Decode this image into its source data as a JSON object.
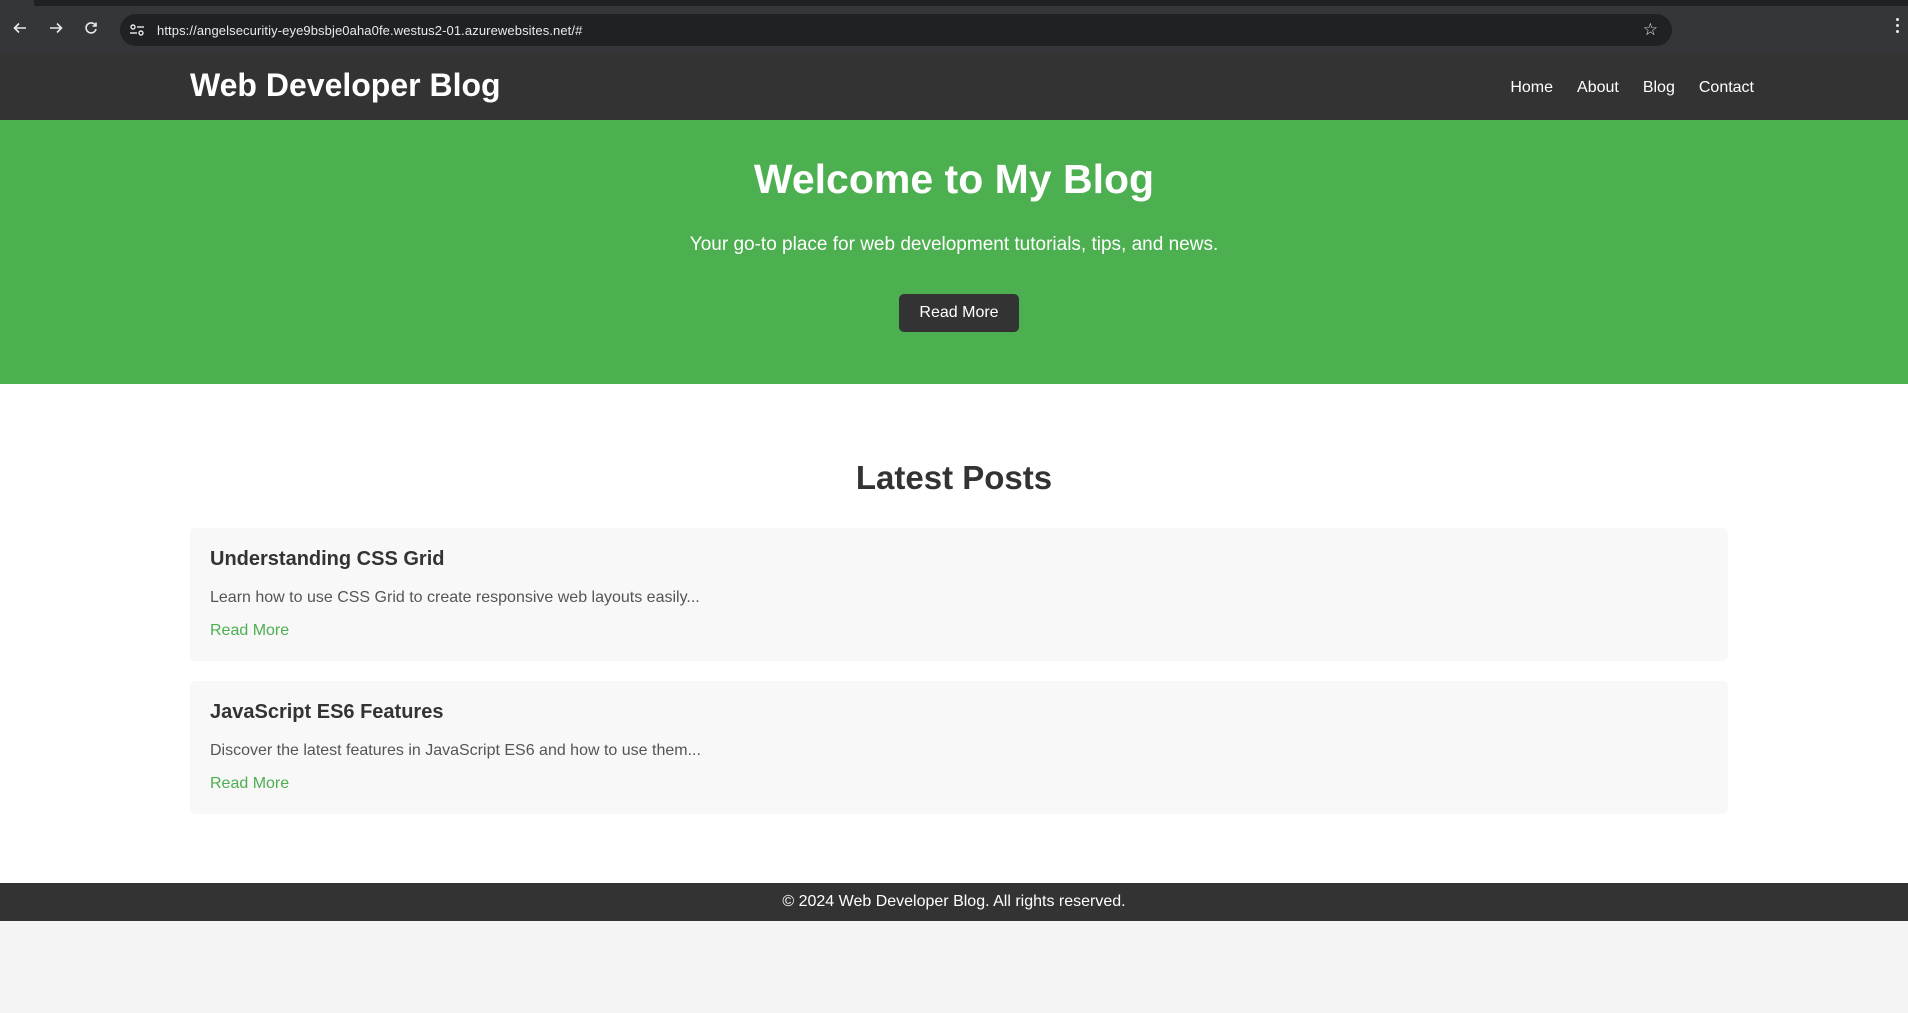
{
  "browser": {
    "url": "https://angelsecuritiy-eye9bsbje0aha0fe.westus2-01.azurewebsites.net/#"
  },
  "header": {
    "title": "Web Developer Blog",
    "nav": [
      "Home",
      "About",
      "Blog",
      "Contact"
    ]
  },
  "hero": {
    "heading": "Welcome to My Blog",
    "subtitle": "Your go-to place for web development tutorials, tips, and news.",
    "button_label": "Read More"
  },
  "posts_section": {
    "heading": "Latest Posts",
    "posts": [
      {
        "title": "Understanding CSS Grid",
        "excerpt": "Learn how to use CSS Grid to create responsive web layouts easily...",
        "link_label": "Read More"
      },
      {
        "title": "JavaScript ES6 Features",
        "excerpt": "Discover the latest features in JavaScript ES6 and how to use them...",
        "link_label": "Read More"
      }
    ]
  },
  "footer": {
    "text": "© 2024 Web Developer Blog. All rights reserved."
  },
  "colors": {
    "header_bg": "#333333",
    "hero_bg": "#4caf50",
    "link": "#4caf50",
    "card_bg": "#f8f8f8"
  },
  "icons": [
    "back-arrow-icon",
    "forward-arrow-icon",
    "reload-icon",
    "site-info-icon",
    "bookmark-star-icon",
    "browser-menu-icon"
  ]
}
